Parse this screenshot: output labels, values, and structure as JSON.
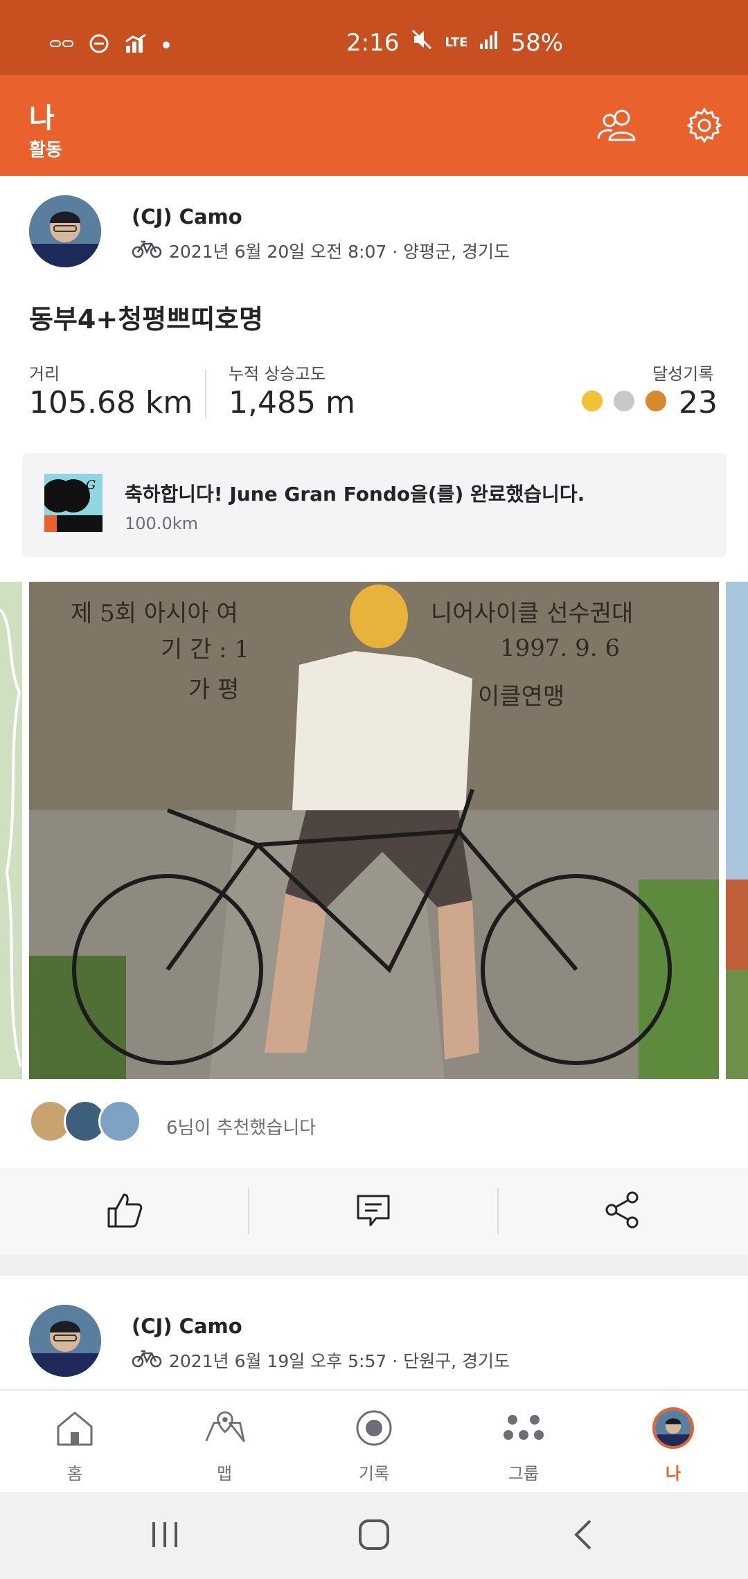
{
  "status_bar": {
    "time": "2:16",
    "network": "LTE",
    "battery": "58%"
  },
  "header": {
    "title": "나",
    "subtitle": "활동",
    "friends_icon": "people-icon",
    "settings_icon": "gear-icon"
  },
  "activities": [
    {
      "athlete": "(CJ) Camo",
      "activity_icon": "bike-icon",
      "meta": "2021년 6월 20일 오전 8:07 · 양평군, 경기도",
      "title": "동부4+청평쁘띠호명",
      "stats": {
        "distance_label": "거리",
        "distance_value": "105.68 km",
        "elevation_label": "누적 상승고도",
        "elevation_value": "1,485 m",
        "achievements_label": "달성기록",
        "achievements_value": "23"
      },
      "achievement_banner": {
        "title": "축하합니다! June Gran Fondo을(를) 완료했습니다.",
        "subtitle": "100.0km"
      },
      "photo_text": {
        "line1": "제 5회 아시아 여",
        "line1b": "니어사이클 선수권대",
        "line2": "기 간 : 1",
        "line2b": "1997. 9. 6",
        "line3": "가 평",
        "line3b": "이클연맹"
      },
      "kudos_text": "6님이 추천했습니다"
    },
    {
      "athlete": "(CJ) Camo",
      "activity_icon": "bike-icon",
      "meta": "2021년 6월 19일 오후 5:57 · 단원구, 경기도"
    }
  ],
  "actions": {
    "kudos_icon": "thumbs-up-icon",
    "comment_icon": "comment-icon",
    "share_icon": "share-icon"
  },
  "bottom_nav": [
    {
      "label": "홈",
      "icon": "home-icon"
    },
    {
      "label": "맵",
      "icon": "map-icon"
    },
    {
      "label": "기록",
      "icon": "record-icon"
    },
    {
      "label": "그룹",
      "icon": "groups-icon"
    },
    {
      "label": "나",
      "icon": "profile-avatar",
      "active": true
    }
  ],
  "colors": {
    "brand": "#e9612d",
    "status_bar": "#c84f1f",
    "active_nav": "#e9612d",
    "gold": "#f1c232",
    "silver": "#c8c8c8",
    "bronze": "#d9892b"
  }
}
